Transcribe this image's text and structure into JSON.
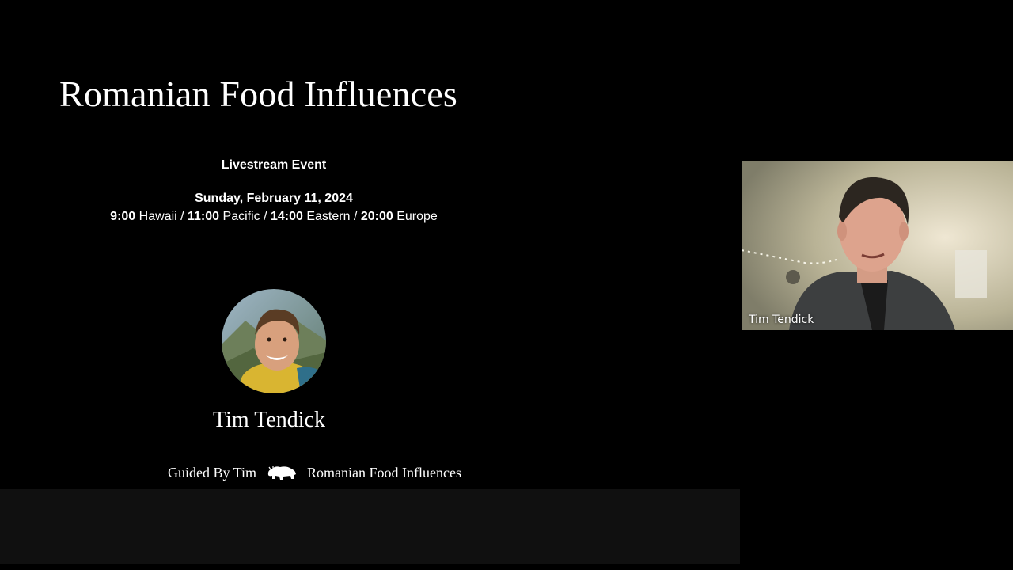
{
  "slide": {
    "title": "Romanian Food Influences",
    "event_label": "Livestream Event",
    "date": "Sunday, February 11, 2024",
    "times": [
      {
        "time": "9:00",
        "zone": "Hawaii"
      },
      {
        "time": "11:00",
        "zone": "Pacific"
      },
      {
        "time": "14:00",
        "zone": "Eastern"
      },
      {
        "time": "20:00",
        "zone": "Europe"
      }
    ],
    "host_name": "Tim Tendick",
    "footer_left": "Guided By Tim",
    "footer_logo_icon": "bison-logo-icon",
    "footer_right": "Romanian Food Influences"
  },
  "participant": {
    "name": "Tim Tendick"
  },
  "colors": {
    "background": "#000000",
    "text": "#ffffff",
    "bottom_band": "#101010"
  }
}
